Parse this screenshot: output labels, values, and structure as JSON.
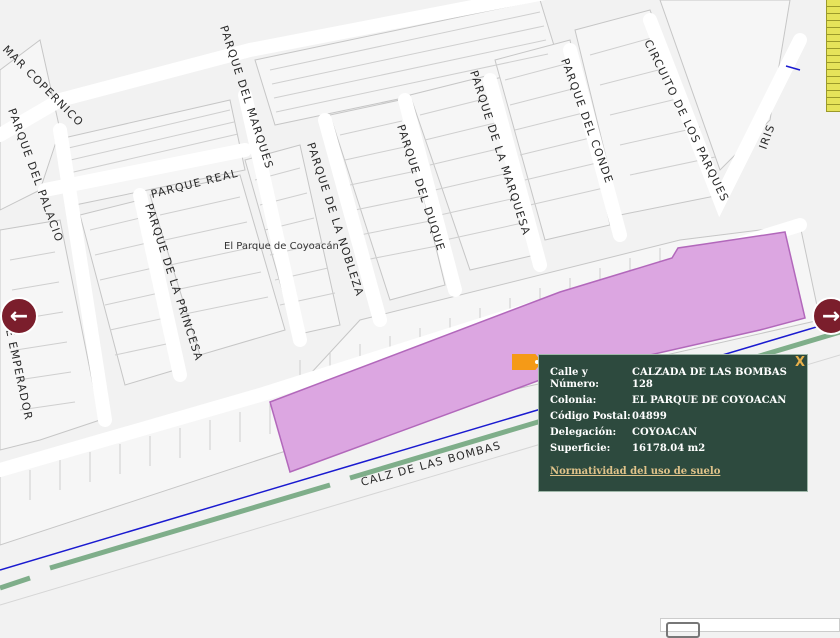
{
  "map": {
    "neighborhood_label": "El Parque de Coyoacán",
    "streets": {
      "mar_copernico": "MAR COPERNICO",
      "parque_del_palacio": "PARQUE DEL PALACIO",
      "parque_del_emperador": "E EMPERADOR",
      "parque_real": "PARQUE REAL",
      "parque_de_la_princesa": "PARQUE DE LA PRINCESA",
      "parque_del_marques": "PARQUE DEL MARQUES",
      "parque_de_la_nobleza": "PARQUE DE LA NOBLEZA",
      "parque_del_duque": "PARQUE DEL DUQUE",
      "parque_de_la_marquesa": "PARQUE DE LA MARQUESA",
      "parque_del_conde": "PARQUE DEL CONDE",
      "circuito_de_los_parques": "CIRCUITO DE LOS PARQUES",
      "iris": "IRIS",
      "calz_de_las_bombas": "CALZ DE LAS BOMBAS"
    },
    "colors": {
      "background": "#f2f2f2",
      "parcel_line": "#c9c9c9",
      "highlight_fill": "#dca6e1",
      "highlight_stroke": "#b268bb",
      "road_green": "#7fae8a",
      "road_blue": "#1a1ad0",
      "nav_button": "#7b1e2c"
    }
  },
  "nav": {
    "left_arrow": "←",
    "right_arrow": "→"
  },
  "popup": {
    "close": "X",
    "rows": [
      {
        "key": "Calle y Número:",
        "value": "CALZADA DE LAS BOMBAS 128"
      },
      {
        "key": "Colonia:",
        "value": "EL PARQUE DE COYOACAN"
      },
      {
        "key": "Código Postal:",
        "value": "04899"
      },
      {
        "key": "Delegación:",
        "value": "COYOACAN"
      },
      {
        "key": "Superficie:",
        "value": "16178.04 m2"
      }
    ],
    "link": "Normatividad del uso de suelo",
    "background": "#2d4a3e"
  }
}
